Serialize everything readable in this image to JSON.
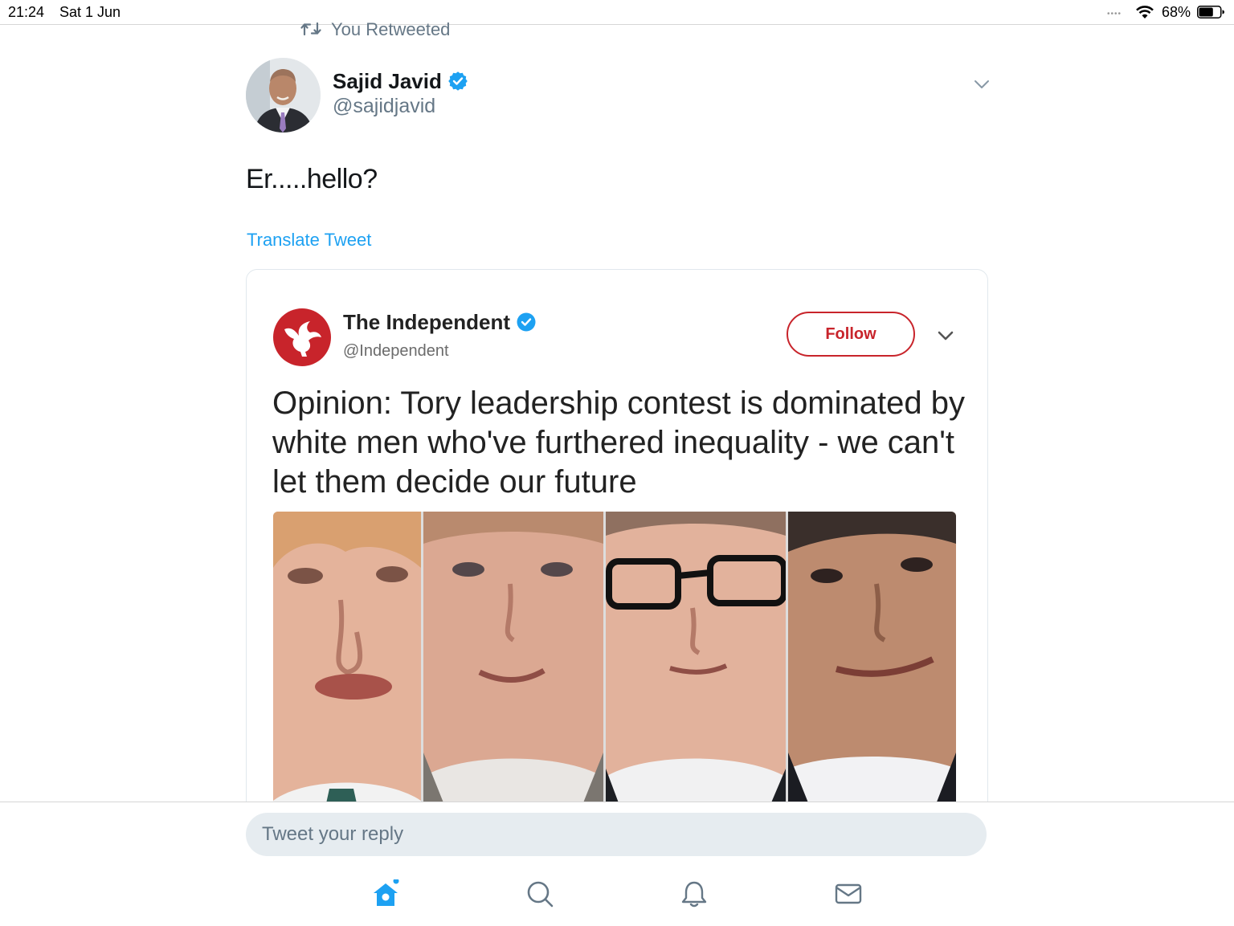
{
  "status_bar": {
    "time": "21:24",
    "date": "Sat 1 Jun",
    "signal": "••••",
    "battery": "68%",
    "battery_level": 0.68
  },
  "retweet": {
    "label": "You Retweeted"
  },
  "tweet": {
    "author_name": "Sajid Javid",
    "author_handle": "@sajidjavid",
    "text": "Er.....hello?",
    "translate_label": "Translate Tweet",
    "verified_color": "#1da1f2",
    "embedded": {
      "account_name": "The Independent",
      "account_handle": "@Independent",
      "follow_label": "Follow",
      "headline": "Opinion: Tory leadership contest is dominated by white men who've furthered inequality - we can't let them decide our future",
      "brand_color": "#c8242b"
    }
  },
  "reply": {
    "placeholder": "Tweet your reply"
  },
  "nav": {
    "items": [
      {
        "icon": "home-icon",
        "active": true
      },
      {
        "icon": "search-icon",
        "active": false
      },
      {
        "icon": "bell-icon",
        "active": false
      },
      {
        "icon": "mail-icon",
        "active": false
      }
    ],
    "accent": "#1da1f2",
    "inactive": "#657786"
  }
}
